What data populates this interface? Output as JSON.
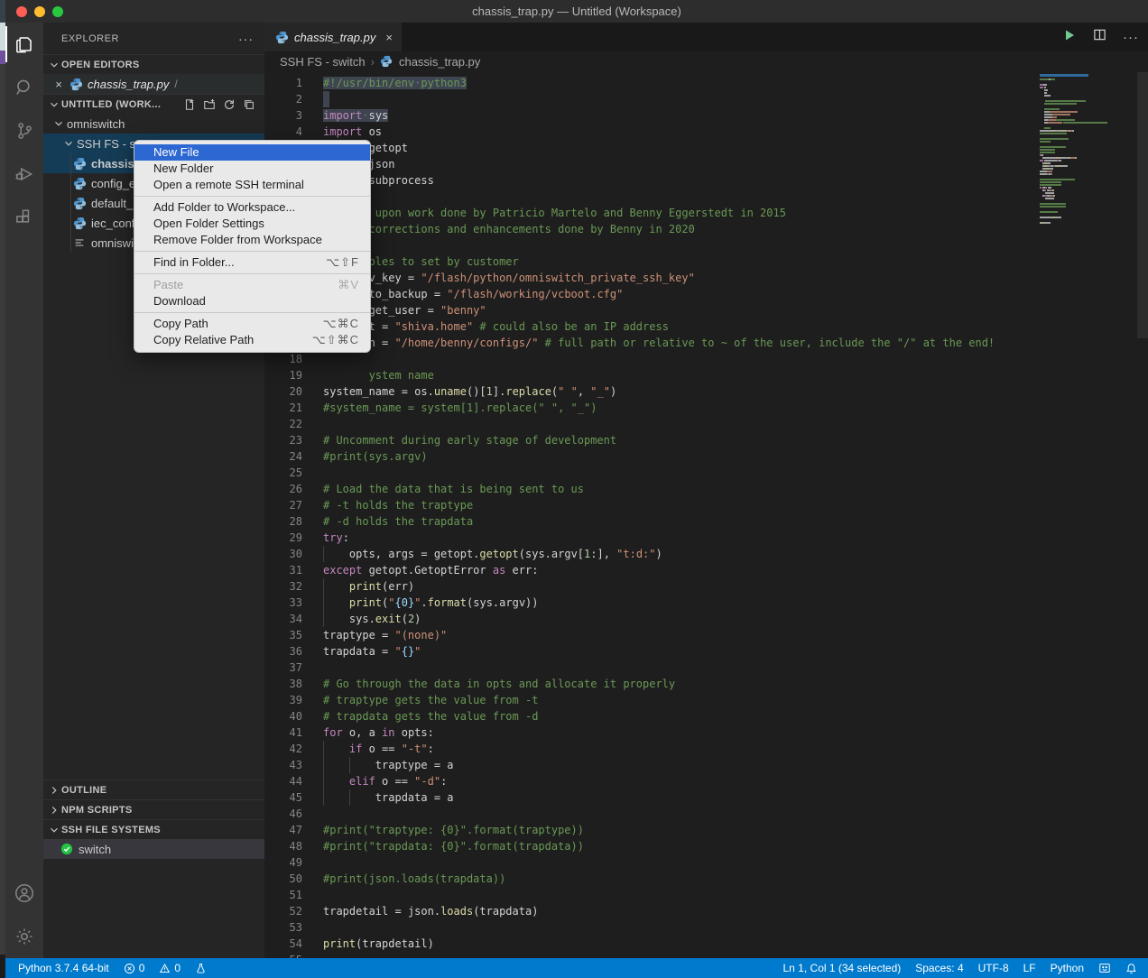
{
  "window": {
    "title": "chassis_trap.py — Untitled (Workspace)"
  },
  "colors": {
    "accent": "#007acc",
    "menu_highlight": "#2d67d2",
    "selection": "#3e4450",
    "run_green": "#73c991"
  },
  "activity_bar": {
    "top": [
      {
        "name": "explorer",
        "active": true
      },
      {
        "name": "search",
        "active": false
      },
      {
        "name": "source-control",
        "active": false
      },
      {
        "name": "run-debug",
        "active": false
      },
      {
        "name": "extensions",
        "active": false
      }
    ],
    "bottom": [
      {
        "name": "accounts"
      },
      {
        "name": "settings"
      }
    ]
  },
  "sidebar": {
    "title": "EXPLORER",
    "open_editors": {
      "label": "OPEN EDITORS",
      "items": [
        {
          "icon": "python",
          "label": "chassis_trap.py",
          "desc": "/"
        }
      ]
    },
    "workspace_label": "UNTITLED (WORK...",
    "workspace_actions": [
      "new-file",
      "new-folder",
      "refresh",
      "collapse-all"
    ],
    "tree": [
      {
        "type": "folder",
        "label": "omniswitch",
        "indent": 0,
        "selected": false
      },
      {
        "type": "folder",
        "label": "SSH FS - s",
        "indent": 1,
        "selected": true
      },
      {
        "type": "file",
        "icon": "python",
        "label": "chassis_t",
        "indent": 2,
        "selected": true
      },
      {
        "type": "file",
        "icon": "python",
        "label": "config_ex",
        "indent": 2,
        "selected": false
      },
      {
        "type": "file",
        "icon": "python",
        "label": "default_b",
        "indent": 2,
        "selected": false
      },
      {
        "type": "file",
        "icon": "python",
        "label": "iec_config",
        "indent": 2,
        "selected": false
      },
      {
        "type": "file",
        "icon": "list",
        "label": "omniswit",
        "indent": 2,
        "selected": false
      }
    ],
    "bottom_sections": [
      {
        "label": "OUTLINE",
        "expanded": false
      },
      {
        "label": "NPM SCRIPTS",
        "expanded": false
      },
      {
        "label": "SSH FILE SYSTEMS",
        "expanded": true,
        "items": [
          {
            "icon": "check-circle",
            "label": "switch"
          }
        ]
      }
    ]
  },
  "context_menu": {
    "groups": [
      [
        {
          "label": "New File",
          "highlighted": true
        },
        {
          "label": "New Folder"
        },
        {
          "label": "Open a remote SSH terminal"
        }
      ],
      [
        {
          "label": "Add Folder to Workspace..."
        },
        {
          "label": "Open Folder Settings"
        },
        {
          "label": "Remove Folder from Workspace"
        }
      ],
      [
        {
          "label": "Find in Folder...",
          "shortcut": "⌥⇧F"
        }
      ],
      [
        {
          "label": "Paste",
          "shortcut": "⌘V",
          "disabled": true
        },
        {
          "label": "Download"
        }
      ],
      [
        {
          "label": "Copy Path",
          "shortcut": "⌥⌘C"
        },
        {
          "label": "Copy Relative Path",
          "shortcut": "⌥⇧⌘C"
        }
      ]
    ]
  },
  "editor": {
    "tab": {
      "label": "chassis_trap.py",
      "close": "×"
    },
    "breadcrumb": {
      "folder": "SSH FS - switch",
      "sep": "›",
      "file": "chassis_trap.py"
    },
    "code": [
      {
        "n": 1,
        "sel": true,
        "seg": [
          [
            "#!/usr/bin/env",
            "c"
          ],
          [
            "·",
            "w"
          ],
          [
            "python3",
            "c"
          ]
        ]
      },
      {
        "n": 2,
        "stub": true,
        "seg": []
      },
      {
        "n": 3,
        "sel": true,
        "seg": [
          [
            "import",
            "k"
          ],
          [
            "·",
            "w"
          ],
          [
            "sys",
            "v"
          ]
        ]
      },
      {
        "n": 4,
        "seg": [
          [
            "import",
            "k"
          ],
          [
            " os",
            "v"
          ]
        ]
      },
      {
        "n": 5,
        "seg": [
          [
            "       getopt",
            "v"
          ]
        ]
      },
      {
        "n": 6,
        "seg": [
          [
            "       json",
            "v"
          ]
        ]
      },
      {
        "n": 7,
        "seg": [
          [
            "       subprocess",
            "v"
          ]
        ]
      },
      {
        "n": 8,
        "seg": []
      },
      {
        "n": 9,
        "seg": [
          [
            "        upon work done by Patricio Martelo and Benny Eggerstedt in 2015",
            "c"
          ]
        ]
      },
      {
        "n": 10,
        "seg": [
          [
            "       corrections and enhancements done by Benny in 2020",
            "c"
          ]
        ]
      },
      {
        "n": 11,
        "seg": []
      },
      {
        "n": 12,
        "seg": [
          [
            "       bles to set by customer",
            "c"
          ]
        ]
      },
      {
        "n": 13,
        "seg": [
          [
            "       v_key ",
            "v"
          ],
          [
            "= ",
            "v"
          ],
          [
            "\"/flash/python/omniswitch_private_ssh_key\"",
            "s"
          ]
        ]
      },
      {
        "n": 14,
        "seg": [
          [
            "       to_backup ",
            "v"
          ],
          [
            "= ",
            "v"
          ],
          [
            "\"/flash/working/vcboot.cfg\"",
            "s"
          ]
        ]
      },
      {
        "n": 15,
        "seg": [
          [
            "       get_user ",
            "v"
          ],
          [
            "= ",
            "v"
          ],
          [
            "\"benny\"",
            "s"
          ]
        ]
      },
      {
        "n": 16,
        "seg": [
          [
            "       t ",
            "v"
          ],
          [
            "= ",
            "v"
          ],
          [
            "\"shiva.home\"",
            "s"
          ],
          [
            " # could also be an IP address",
            "c"
          ]
        ]
      },
      {
        "n": 17,
        "seg": [
          [
            "       h ",
            "v"
          ],
          [
            "= ",
            "v"
          ],
          [
            "\"/home/benny/configs/\"",
            "s"
          ],
          [
            " # full path or relative to ~ of the user, include the \"/\" at the end!",
            "c"
          ]
        ]
      },
      {
        "n": 18,
        "seg": []
      },
      {
        "n": 19,
        "seg": [
          [
            "       ystem name",
            "c"
          ]
        ]
      },
      {
        "n": 20,
        "seg": [
          [
            "system_name ",
            "v"
          ],
          [
            "= ",
            "v"
          ],
          [
            "os.",
            "v"
          ],
          [
            "uname",
            "f"
          ],
          [
            "()[",
            "v"
          ],
          [
            "1",
            "n"
          ],
          [
            "].",
            "v"
          ],
          [
            "replace",
            "f"
          ],
          [
            "(",
            "v"
          ],
          [
            "\" \"",
            "s"
          ],
          [
            ", ",
            "v"
          ],
          [
            "\"_\"",
            "s"
          ],
          [
            ")",
            "v"
          ]
        ]
      },
      {
        "n": 21,
        "seg": [
          [
            "#system_name = system[1].replace(\" \", \"_\")",
            "c"
          ]
        ]
      },
      {
        "n": 22,
        "seg": []
      },
      {
        "n": 23,
        "seg": [
          [
            "# Uncomment during early stage of development",
            "c"
          ]
        ]
      },
      {
        "n": 24,
        "seg": [
          [
            "#print(sys.argv)",
            "c"
          ]
        ]
      },
      {
        "n": 25,
        "seg": []
      },
      {
        "n": 26,
        "seg": [
          [
            "# Load the data that is being sent to us",
            "c"
          ]
        ]
      },
      {
        "n": 27,
        "seg": [
          [
            "# -t holds the traptype",
            "c"
          ]
        ]
      },
      {
        "n": 28,
        "seg": [
          [
            "# -d holds the trapdata",
            "c"
          ]
        ]
      },
      {
        "n": 29,
        "seg": [
          [
            "try",
            "k"
          ],
          [
            ":",
            "v"
          ]
        ]
      },
      {
        "n": 30,
        "g": 1,
        "seg": [
          [
            "    opts, args ",
            "v"
          ],
          [
            "= ",
            "v"
          ],
          [
            "getopt.",
            "v"
          ],
          [
            "getopt",
            "f"
          ],
          [
            "(sys.argv[",
            "v"
          ],
          [
            "1",
            "n"
          ],
          [
            ":], ",
            "v"
          ],
          [
            "\"t:d:\"",
            "s"
          ],
          [
            ")",
            "v"
          ]
        ]
      },
      {
        "n": 31,
        "seg": [
          [
            "except",
            "k"
          ],
          [
            " getopt.GetoptError ",
            "v"
          ],
          [
            "as",
            "k"
          ],
          [
            " err:",
            "v"
          ]
        ]
      },
      {
        "n": 32,
        "g": 1,
        "seg": [
          [
            "    ",
            "v"
          ],
          [
            "print",
            "f"
          ],
          [
            "(err)",
            "v"
          ]
        ]
      },
      {
        "n": 33,
        "g": 1,
        "seg": [
          [
            "    ",
            "v"
          ],
          [
            "print",
            "f"
          ],
          [
            "(",
            "v"
          ],
          [
            "\"",
            "s"
          ],
          [
            "{0}",
            "b"
          ],
          [
            "\"",
            "s"
          ],
          [
            ".",
            "v"
          ],
          [
            "format",
            "f"
          ],
          [
            "(sys.argv))",
            "v"
          ]
        ]
      },
      {
        "n": 34,
        "g": 1,
        "seg": [
          [
            "    sys.",
            "v"
          ],
          [
            "exit",
            "f"
          ],
          [
            "(",
            "v"
          ],
          [
            "2",
            "n"
          ],
          [
            ")",
            "v"
          ]
        ]
      },
      {
        "n": 35,
        "seg": [
          [
            "traptype ",
            "v"
          ],
          [
            "= ",
            "v"
          ],
          [
            "\"(none)\"",
            "s"
          ]
        ]
      },
      {
        "n": 36,
        "seg": [
          [
            "trapdata ",
            "v"
          ],
          [
            "= ",
            "v"
          ],
          [
            "\"",
            "s"
          ],
          [
            "{}",
            "b"
          ],
          [
            "\"",
            "s"
          ]
        ]
      },
      {
        "n": 37,
        "seg": []
      },
      {
        "n": 38,
        "seg": [
          [
            "# Go through the data in opts and allocate it properly",
            "c"
          ]
        ]
      },
      {
        "n": 39,
        "seg": [
          [
            "# traptype gets the value from -t",
            "c"
          ]
        ]
      },
      {
        "n": 40,
        "seg": [
          [
            "# trapdata gets the value from -d",
            "c"
          ]
        ]
      },
      {
        "n": 41,
        "seg": [
          [
            "for",
            "k"
          ],
          [
            " o, a ",
            "v"
          ],
          [
            "in",
            "k"
          ],
          [
            " opts:",
            "v"
          ]
        ]
      },
      {
        "n": 42,
        "g": 1,
        "seg": [
          [
            "    ",
            "v"
          ],
          [
            "if",
            "k"
          ],
          [
            " o == ",
            "v"
          ],
          [
            "\"-t\"",
            "s"
          ],
          [
            ":",
            "v"
          ]
        ]
      },
      {
        "n": 43,
        "g": 2,
        "seg": [
          [
            "        traptype ",
            "v"
          ],
          [
            "= ",
            "v"
          ],
          [
            "a",
            "v"
          ]
        ]
      },
      {
        "n": 44,
        "g": 1,
        "seg": [
          [
            "    ",
            "v"
          ],
          [
            "elif",
            "k"
          ],
          [
            " o == ",
            "v"
          ],
          [
            "\"-d\"",
            "s"
          ],
          [
            ":",
            "v"
          ]
        ]
      },
      {
        "n": 45,
        "g": 2,
        "seg": [
          [
            "        trapdata ",
            "v"
          ],
          [
            "= ",
            "v"
          ],
          [
            "a",
            "v"
          ]
        ]
      },
      {
        "n": 46,
        "seg": []
      },
      {
        "n": 47,
        "seg": [
          [
            "#print(\"traptype: {0}\".format(traptype))",
            "c"
          ]
        ]
      },
      {
        "n": 48,
        "seg": [
          [
            "#print(\"trapdata: {0}\".format(trapdata))",
            "c"
          ]
        ]
      },
      {
        "n": 49,
        "seg": []
      },
      {
        "n": 50,
        "seg": [
          [
            "#print(json.loads(trapdata))",
            "c"
          ]
        ]
      },
      {
        "n": 51,
        "seg": []
      },
      {
        "n": 52,
        "seg": [
          [
            "trapdetail ",
            "v"
          ],
          [
            "= ",
            "v"
          ],
          [
            "json.",
            "v"
          ],
          [
            "loads",
            "f"
          ],
          [
            "(trapdata)",
            "v"
          ]
        ]
      },
      {
        "n": 53,
        "seg": []
      },
      {
        "n": 54,
        "seg": [
          [
            "print",
            "f"
          ],
          [
            "(trapdetail)",
            "v"
          ]
        ]
      },
      {
        "n": 55,
        "seg": []
      }
    ]
  },
  "status_bar": {
    "left": [
      {
        "label": "Python 3.7.4 64-bit"
      },
      {
        "icon": "error",
        "label": "0"
      },
      {
        "icon": "warning",
        "label": "0"
      },
      {
        "icon": "flask",
        "label": ""
      }
    ],
    "right": [
      {
        "label": "Ln 1, Col 1 (34 selected)"
      },
      {
        "label": "Spaces: 4"
      },
      {
        "label": "UTF-8"
      },
      {
        "label": "LF"
      },
      {
        "label": "Python"
      },
      {
        "icon": "feedback",
        "label": ""
      },
      {
        "icon": "bell",
        "label": ""
      }
    ]
  }
}
